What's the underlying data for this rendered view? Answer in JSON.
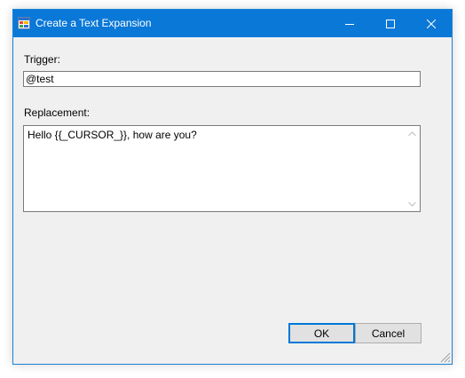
{
  "window": {
    "title": "Create a Text Expansion",
    "icon": "app-form-icon",
    "controls": {
      "minimize_icon": "minimize-icon",
      "maximize_icon": "maximize-icon",
      "close_icon": "close-icon"
    }
  },
  "form": {
    "trigger_label": "Trigger:",
    "trigger_value": "@test",
    "replacement_label": "Replacement:",
    "replacement_value": "Hello {{_CURSOR_}}, how are you?"
  },
  "buttons": {
    "ok_label": "OK",
    "cancel_label": "Cancel"
  },
  "colors": {
    "titlebar": "#0a78d7",
    "window_bg": "#f0f0f0",
    "default_button_border": "#0078d7"
  }
}
